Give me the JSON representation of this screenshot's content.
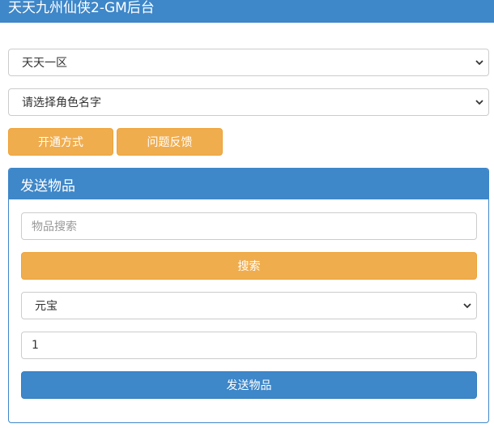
{
  "header": {
    "title": "天天九州仙侠2-GM后台"
  },
  "server_select": {
    "value": "天天一区",
    "icon": "chevron-down-icon"
  },
  "role_select": {
    "value": "请选择角色名字",
    "icon": "chevron-down-icon"
  },
  "buttons": {
    "open_method": "开通方式",
    "feedback": "问题反馈"
  },
  "send_panel": {
    "title": "发送物品",
    "search_placeholder": "物品搜索",
    "search_button": "搜索",
    "item_select": "元宝",
    "quantity": "1",
    "send_button": "发送物品"
  },
  "colors": {
    "primary": "#3e87c9",
    "warning": "#f0ad4e"
  }
}
